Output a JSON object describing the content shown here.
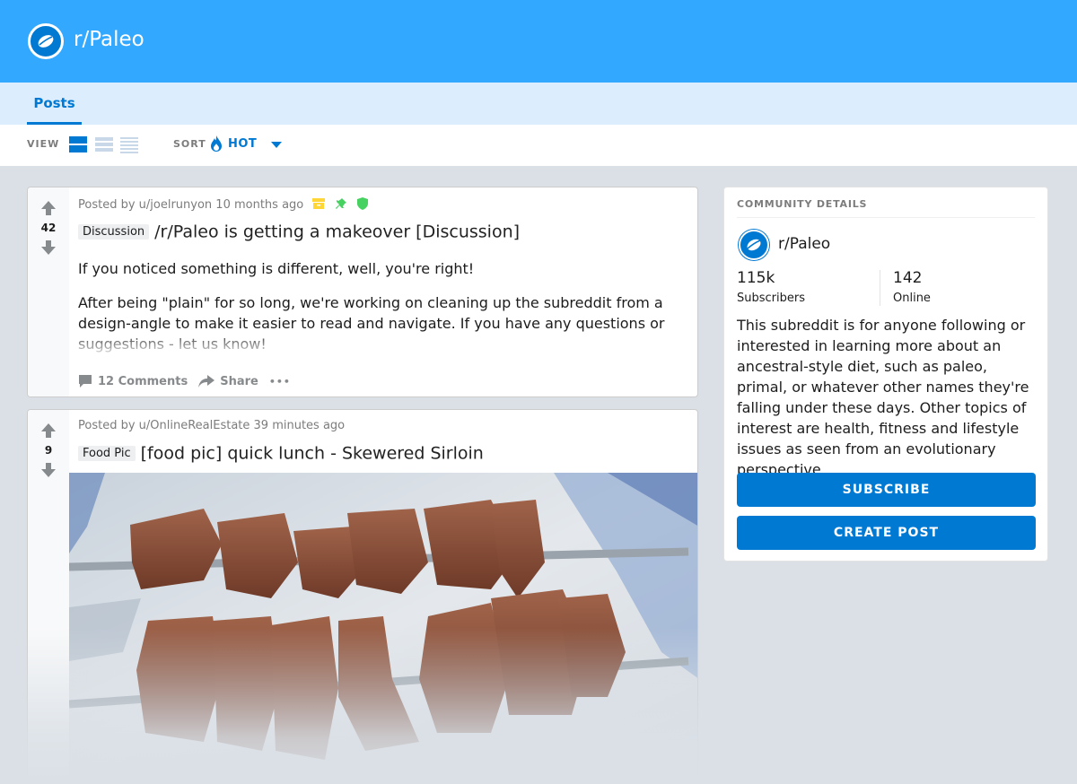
{
  "header": {
    "title": "r/Paleo"
  },
  "tabs": [
    {
      "label": "Posts"
    }
  ],
  "viewbar": {
    "view_label": "VIEW",
    "sort_label": "SORT",
    "sort_value": "HOT"
  },
  "posts": [
    {
      "votes": "42",
      "meta": "Posted by u/joelrunyon 10 months ago",
      "flair": "Discussion",
      "title": "/r/Paleo is getting a makeover [Discussion]",
      "body": [
        "If you noticed something is different, well, you're right!",
        "After being \"plain\" for so long, we're working on cleaning up the subreddit from a design-angle to make it easier to read and navigate. If you have any questions or suggestions - let us know!"
      ],
      "comments": "12 Comments",
      "share": "Share",
      "more": "•••"
    },
    {
      "votes": "9",
      "meta": "Posted by u/OnlineRealEstate 39 minutes ago",
      "flair": "Food Pic",
      "title": "[food pic] quick lunch - Skewered Sirloin"
    }
  ],
  "sidebar": {
    "header": "COMMUNITY DETAILS",
    "name": "r/Paleo",
    "subscribers_value": "115k",
    "subscribers_label": "Subscribers",
    "online_value": "142",
    "online_label": "Online",
    "description": "This subreddit is for anyone following or interested in learning more about an ancestral-style diet, such as paleo, primal, or whatever other names they're falling under these days. Other topics of interest are health, fitness and lifestyle issues as seen from an evolutionary perspective.",
    "subscribe_label": "SUBSCRIBE",
    "create_post_label": "CREATE POST"
  },
  "colors": {
    "header": "#33a8ff",
    "accent": "#0079d3",
    "tabs_bg": "#dceefe",
    "page_bg": "#dae0e6"
  }
}
